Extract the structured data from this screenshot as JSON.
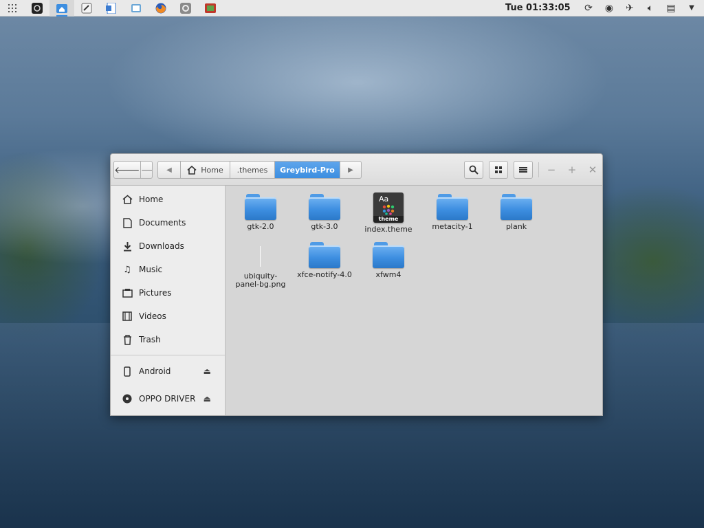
{
  "panel": {
    "clock": "Tue 01:33:05",
    "apps": [
      {
        "name": "apps-grid",
        "color": "#666"
      },
      {
        "name": "terminal",
        "color": "#222"
      },
      {
        "name": "files",
        "color": "#3d8ee0"
      },
      {
        "name": "text-editor",
        "color": "#555"
      },
      {
        "name": "word-processor",
        "color": "#3b7bd0"
      },
      {
        "name": "screenshot",
        "color": "#4a90c8"
      },
      {
        "name": "firefox",
        "color": "#e56a1f"
      },
      {
        "name": "settings",
        "color": "#777"
      },
      {
        "name": "presentation",
        "color": "#c0392b"
      }
    ]
  },
  "window": {
    "breadcrumbs": {
      "home": "Home",
      "themes": ".themes",
      "current": "Greybird-Pro"
    },
    "sidebar": {
      "places": [
        {
          "label": "Home",
          "icon": "home-icon"
        },
        {
          "label": "Documents",
          "icon": "document-icon"
        },
        {
          "label": "Downloads",
          "icon": "download-icon"
        },
        {
          "label": "Music",
          "icon": "music-icon"
        },
        {
          "label": "Pictures",
          "icon": "pictures-icon"
        },
        {
          "label": "Videos",
          "icon": "video-icon"
        },
        {
          "label": "Trash",
          "icon": "trash-icon"
        }
      ],
      "devices": [
        {
          "label": "Android",
          "icon": "phone-icon"
        },
        {
          "label": "OPPO DRIVER",
          "icon": "disc-icon"
        }
      ]
    },
    "files": [
      {
        "name": "gtk-2.0",
        "type": "folder"
      },
      {
        "name": "gtk-3.0",
        "type": "folder"
      },
      {
        "name": "index.theme",
        "type": "theme"
      },
      {
        "name": "metacity-1",
        "type": "folder"
      },
      {
        "name": "plank",
        "type": "folder"
      },
      {
        "name": "ubiquity-panel-bg.png",
        "type": "image"
      },
      {
        "name": "xfce-notify-4.0",
        "type": "folder"
      },
      {
        "name": "xfwm4",
        "type": "folder"
      }
    ],
    "theme_icon": {
      "aa": "Aa",
      "band": "theme"
    }
  }
}
